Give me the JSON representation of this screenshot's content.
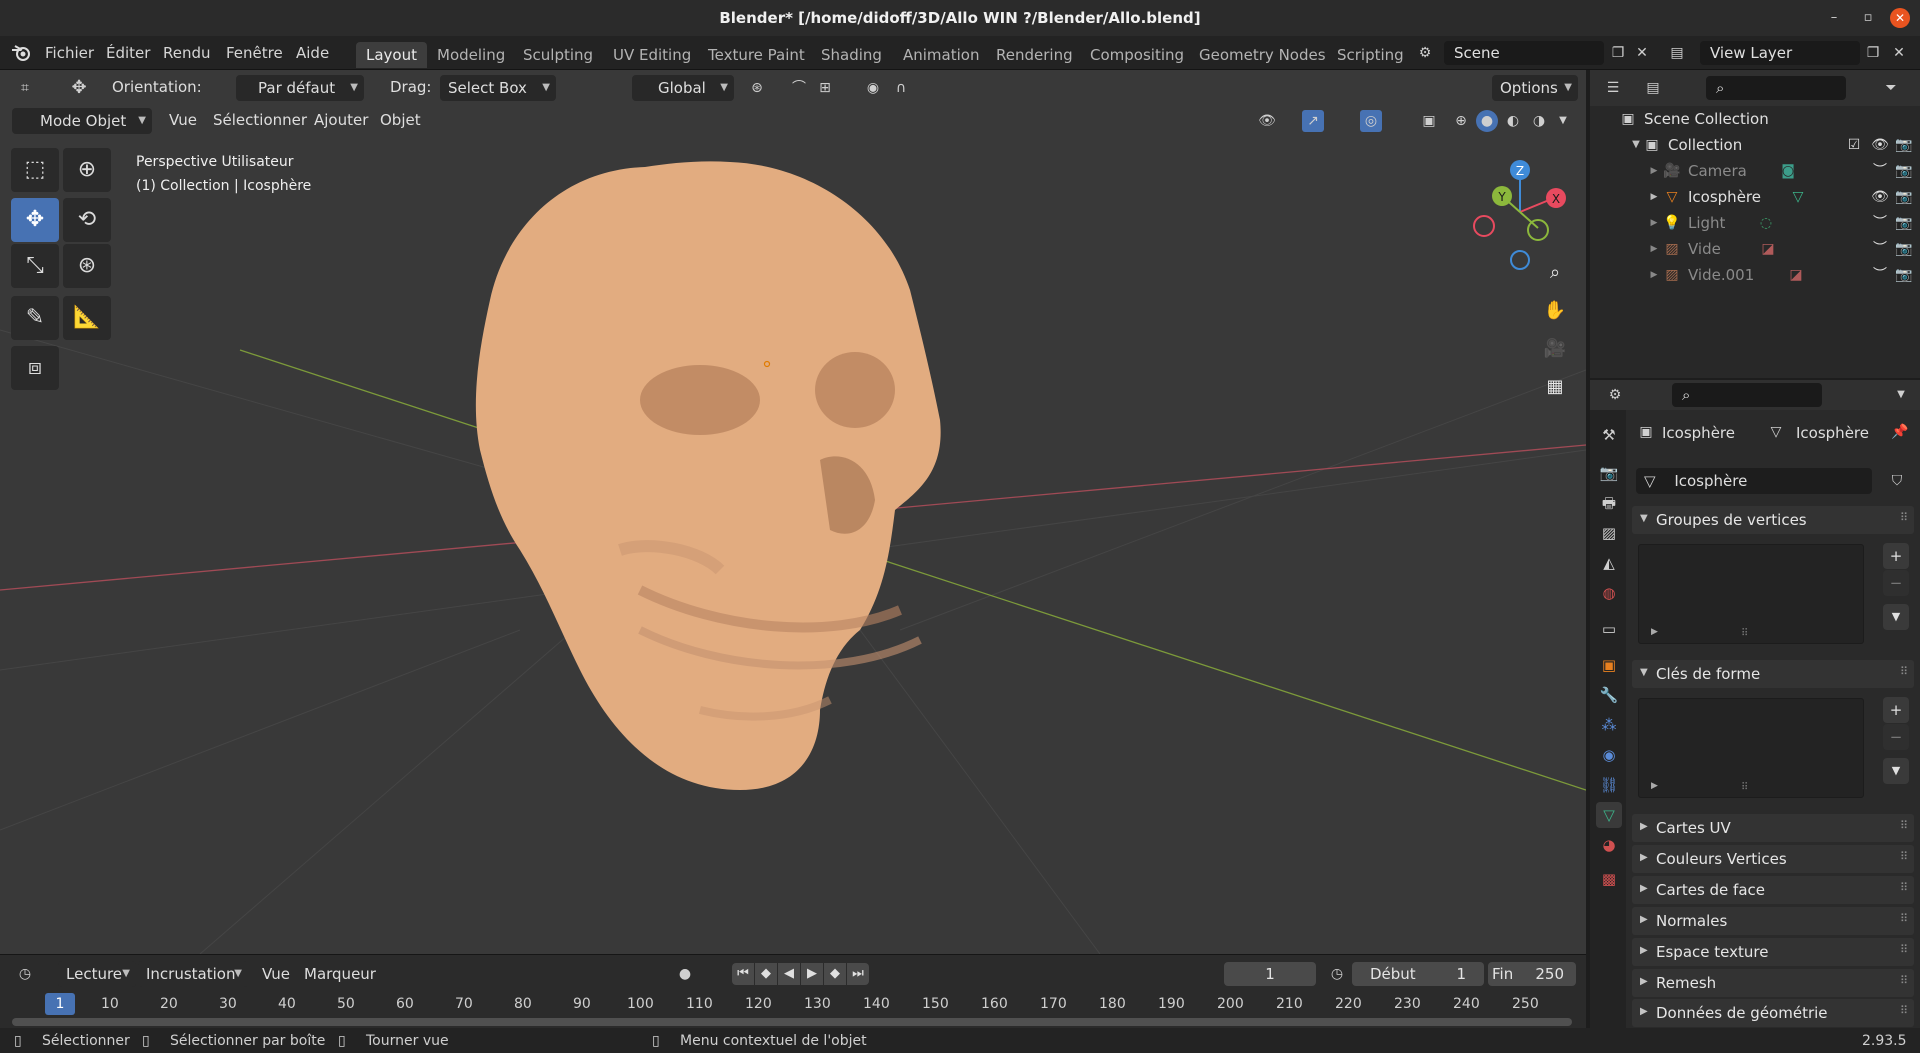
{
  "window": {
    "title": "Blender* [/home/didoff/3D/Allo WIN ?/Blender/Allo.blend]",
    "minimize": "–",
    "maximize": "▫",
    "close": "✕"
  },
  "menu": {
    "items": [
      "Fichier",
      "Éditer",
      "Rendu",
      "Fenêtre",
      "Aide"
    ]
  },
  "workspaces": [
    "Layout",
    "Modeling",
    "Sculpting",
    "UV Editing",
    "Texture Paint",
    "Shading",
    "Animation",
    "Rendering",
    "Compositing",
    "Geometry Nodes",
    "Scripting"
  ],
  "scene": {
    "name": "Scene"
  },
  "view_layer": {
    "name": "View Layer"
  },
  "viewport_header": {
    "orientation_label": "Orientation:",
    "orientation_value": "Par défaut",
    "drag_label": "Drag:",
    "drag_value": "Select Box",
    "transform_value": "Global",
    "options_label": "Options"
  },
  "viewport_header2": {
    "mode": "Mode Objet",
    "menus": [
      "Vue",
      "Sélectionner",
      "Ajouter",
      "Objet"
    ]
  },
  "viewport_info": {
    "line1": "Perspective Utilisateur",
    "line2": "(1) Collection | Icosphère"
  },
  "gizmo": {
    "x": "X",
    "y": "Y",
    "z": "Z"
  },
  "timeline": {
    "menus": [
      "Lecture",
      "Incrustation",
      "Vue",
      "Marqueur"
    ],
    "current_frame": "1",
    "start_label": "Début",
    "start_value": "1",
    "end_label": "Fin",
    "end_value": "250",
    "ruler": [
      "10",
      "20",
      "30",
      "40",
      "50",
      "60",
      "70",
      "80",
      "90",
      "100",
      "110",
      "120",
      "130",
      "140",
      "150",
      "160",
      "170",
      "180",
      "190",
      "200",
      "210",
      "220",
      "230",
      "240",
      "250"
    ],
    "ruler_current": "1"
  },
  "statusbar": {
    "items": [
      "Sélectionner",
      "Sélectionner par boîte",
      "Tourner vue",
      "Menu contextuel de l'objet"
    ],
    "version": "2.93.5"
  },
  "outliner": {
    "scene_collection": "Scene Collection",
    "collection": "Collection",
    "objects": [
      "Camera",
      "Icosphère",
      "Light",
      "Vide",
      "Vide.001"
    ]
  },
  "properties": {
    "breadcrumb_object": "Icosphère",
    "breadcrumb_mesh": "Icosphère",
    "mesh_name": "Icosphère",
    "panels_open": [
      "Groupes de vertices",
      "Clés de forme"
    ],
    "panels_closed": [
      "Cartes UV",
      "Couleurs Vertices",
      "Cartes de face",
      "Normales",
      "Espace texture",
      "Remesh",
      "Données de géométrie"
    ]
  },
  "colors": {
    "accent": "#4772b3",
    "skull": "#e2ac80",
    "axis_x": "#e84a5f",
    "axis_y": "#8cb83c",
    "axis_z": "#3f8bd8"
  }
}
